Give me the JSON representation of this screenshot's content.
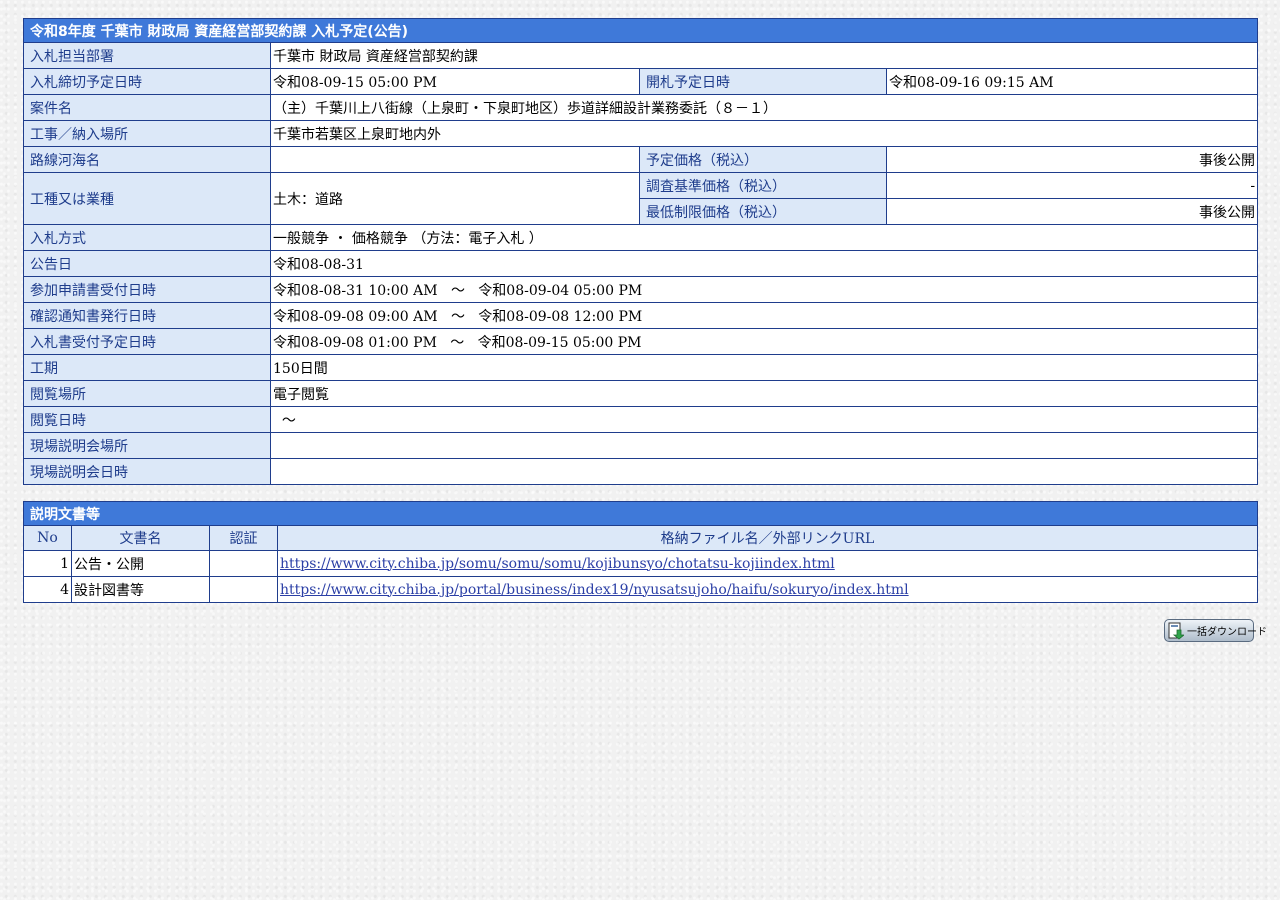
{
  "main": {
    "title": "令和8年度  千葉市  財政局  資産経営部契約課  入札予定(公告)",
    "rows": {
      "dept": {
        "label": "入札担当部署",
        "value": "千葉市  財政局  資産経営部契約課"
      },
      "deadline": {
        "label": "入札締切予定日時",
        "value": "令和08-09-15 05:00 PM"
      },
      "opening": {
        "label": "開札予定日時",
        "value": "令和08-09-16 09:15 AM"
      },
      "project": {
        "label": "案件名",
        "value": "（主）千葉川上八街線（上泉町・下泉町地区）歩道詳細設計業務委託（８－１）"
      },
      "place": {
        "label": "工事／納入場所",
        "value": "千葉市若葉区上泉町地内外"
      },
      "route": {
        "label": "路線河海名",
        "value": ""
      },
      "planned_price": {
        "label": "予定価格（税込）",
        "value": "事後公開"
      },
      "category": {
        "label": "工種又は業種",
        "value": "土木：道路"
      },
      "survey_price": {
        "label": "調査基準価格（税込）",
        "value": "-"
      },
      "min_price": {
        "label": "最低制限価格（税込）",
        "value": "事後公開"
      },
      "method": {
        "label": "入札方式",
        "value": "一般競争 ・ 価格競争 （方法：電子入札 ）"
      },
      "notice_date": {
        "label": "公告日",
        "value": "令和08-08-31"
      },
      "application": {
        "label": "参加申請書受付日時",
        "value": "令和08-08-31 10:00 AM   ～   令和08-09-04 05:00 PM"
      },
      "confirmation": {
        "label": "確認通知書発行日時",
        "value": "令和08-09-08 09:00 AM   ～   令和08-09-08 12:00 PM"
      },
      "bid_reception": {
        "label": "入札書受付予定日時",
        "value": "令和08-09-08 01:00 PM   ～   令和08-09-15 05:00 PM"
      },
      "period": {
        "label": "工期",
        "value": "150日間"
      },
      "viewing_place": {
        "label": "閲覧場所",
        "value": "電子閲覧"
      },
      "viewing_time": {
        "label": "閲覧日時",
        "value": "  ～"
      },
      "site_place": {
        "label": "現場説明会場所",
        "value": ""
      },
      "site_time": {
        "label": "現場説明会日時",
        "value": ""
      }
    }
  },
  "docs": {
    "title": "説明文書等",
    "headers": {
      "no": "No",
      "name": "文書名",
      "auth": "認証",
      "url": "格納ファイル名／外部リンクURL"
    },
    "rows": [
      {
        "no": "1",
        "name": "公告・公開",
        "auth": "",
        "url": "https://www.city.chiba.jp/somu/somu/somu/kojibunsyo/chotatsu-kojiindex.html"
      },
      {
        "no": "4",
        "name": "設計図書等",
        "auth": "",
        "url": "https://www.city.chiba.jp/portal/business/index19/nyusatsujoho/haifu/sokuryo/index.html"
      }
    ]
  },
  "actions": {
    "bulk_download_label": "一括ダウンロード",
    "icon": "download-icon"
  },
  "colors": {
    "title_bg": "#3f79d9",
    "label_bg": "#dce8f8",
    "border": "#1f3d8c",
    "link": "#2b3fa6"
  }
}
